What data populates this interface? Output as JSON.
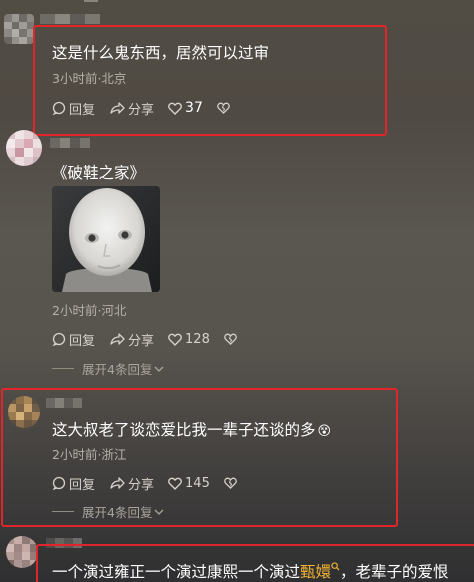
{
  "comments": [
    {
      "text": "这是什么鬼东西，居然可以过审",
      "meta": "3小时前·北京",
      "reply_label": "回复",
      "share_label": "分享",
      "likes": "37"
    },
    {
      "text": "《破鞋之家》",
      "meta": "2小时前·河北",
      "reply_label": "回复",
      "share_label": "分享",
      "likes": "128",
      "expand_label": "展开4条回复"
    },
    {
      "text": "这大叔老了谈恋爱比我一辈子还谈的多",
      "emoji": "😵",
      "meta": "2小时前·浙江",
      "reply_label": "回复",
      "share_label": "分享",
      "likes": "145",
      "expand_label": "展开4条回复"
    },
    {
      "text_before": "一个演过雍正一个演过康熙一个演过",
      "link_text": "甄嬛",
      "text_after": "，老辈子的爱恨"
    }
  ],
  "icons": {
    "reply": "reply-bubble-icon",
    "share": "share-arrow-icon",
    "like": "heart-icon",
    "dislike": "broken-heart-icon",
    "search": "search-icon",
    "chevron": "chevron-down-icon"
  },
  "colors": {
    "highlight_box": "#e0262a",
    "link": "#f2b233"
  }
}
